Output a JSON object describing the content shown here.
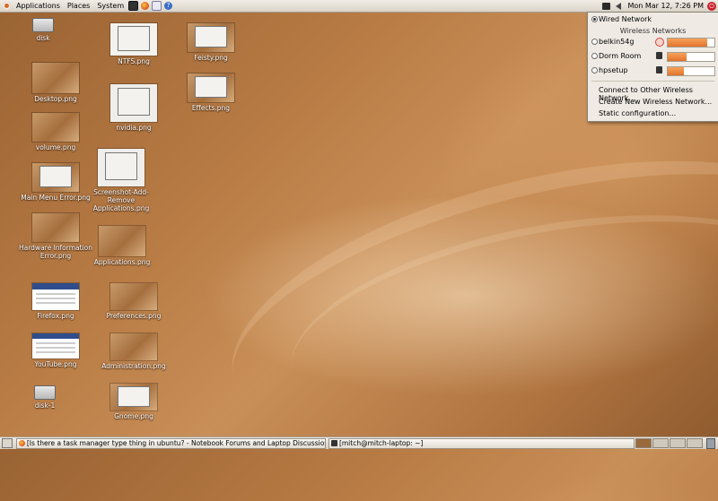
{
  "top_panel": {
    "menus": [
      "Applications",
      "Places",
      "System"
    ],
    "clock": "Mon Mar 12,  7:26 PM"
  },
  "desktop_icons": [
    {
      "id": "disk",
      "label": "disk"
    },
    {
      "id": "desktop",
      "label": "Desktop.png"
    },
    {
      "id": "volume",
      "label": "volume.png"
    },
    {
      "id": "main-menu-error",
      "label": "Main Menu Error.png"
    },
    {
      "id": "hardware-info-error",
      "label": "Hardware Information Error.png"
    },
    {
      "id": "firefox",
      "label": "Firefox.png"
    },
    {
      "id": "youtube",
      "label": "YouTube.png"
    },
    {
      "id": "disk-1",
      "label": "disk-1"
    },
    {
      "id": "ntfs",
      "label": "NTFS.png"
    },
    {
      "id": "nvidia",
      "label": "nvidia.png"
    },
    {
      "id": "screenshot-add-remove",
      "label": "Screenshot-Add-Remove Applications.png"
    },
    {
      "id": "applications",
      "label": "Applications.png"
    },
    {
      "id": "preferences",
      "label": "Preferences.png"
    },
    {
      "id": "administration",
      "label": "Administration.png"
    },
    {
      "id": "gnome",
      "label": "Gnome.png"
    },
    {
      "id": "feisty",
      "label": "Feisty.png"
    },
    {
      "id": "effects",
      "label": "Effects.png"
    }
  ],
  "network_menu": {
    "wired": "Wired Network",
    "wireless_header": "Wireless Networks",
    "networks": [
      {
        "name": "belkin54g",
        "signal": 0.85,
        "icon": "lock-icon"
      },
      {
        "name": "Dorm Room",
        "signal": 0.4,
        "icon": "signal-icon"
      },
      {
        "name": "hpsetup",
        "signal": 0.35,
        "icon": "signal-icon"
      }
    ],
    "actions": [
      "Connect to Other Wireless Network...",
      "Create New Wireless Network...",
      "Static configuration..."
    ]
  },
  "bottom_panel": {
    "tasks": [
      "[Is there a task manager type thing in ubuntu? - Notebook Forums and Laptop Discussion - ...",
      "[mitch@mitch-laptop: ~]"
    ]
  }
}
